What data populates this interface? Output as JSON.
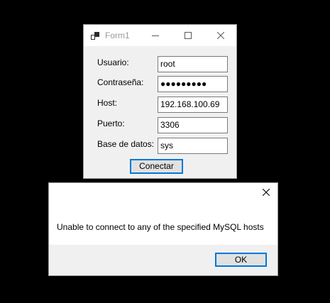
{
  "form": {
    "title": "Form1",
    "icons": {
      "app": "windows-form-icon",
      "minimize": "minimize-icon",
      "maximize": "maximize-icon",
      "close": "close-icon"
    },
    "fields": [
      {
        "label": "Usuario:",
        "value": "root"
      },
      {
        "label": "Contraseña:",
        "value": "●●●●●●●●●"
      },
      {
        "label": "Host:",
        "value": "192.168.100.69"
      },
      {
        "label": "Puerto:",
        "value": "3306"
      },
      {
        "label": "Base de datos:",
        "value": "sys"
      }
    ],
    "connect_label": "Conectar"
  },
  "message_box": {
    "message": "Unable to connect to any of the specified MySQL hosts",
    "ok_label": "OK",
    "close_icon": "close-icon"
  },
  "colors": {
    "accent": "#0078d7",
    "window_bg": "#f0f0f0",
    "screen_bg": "#000000"
  }
}
